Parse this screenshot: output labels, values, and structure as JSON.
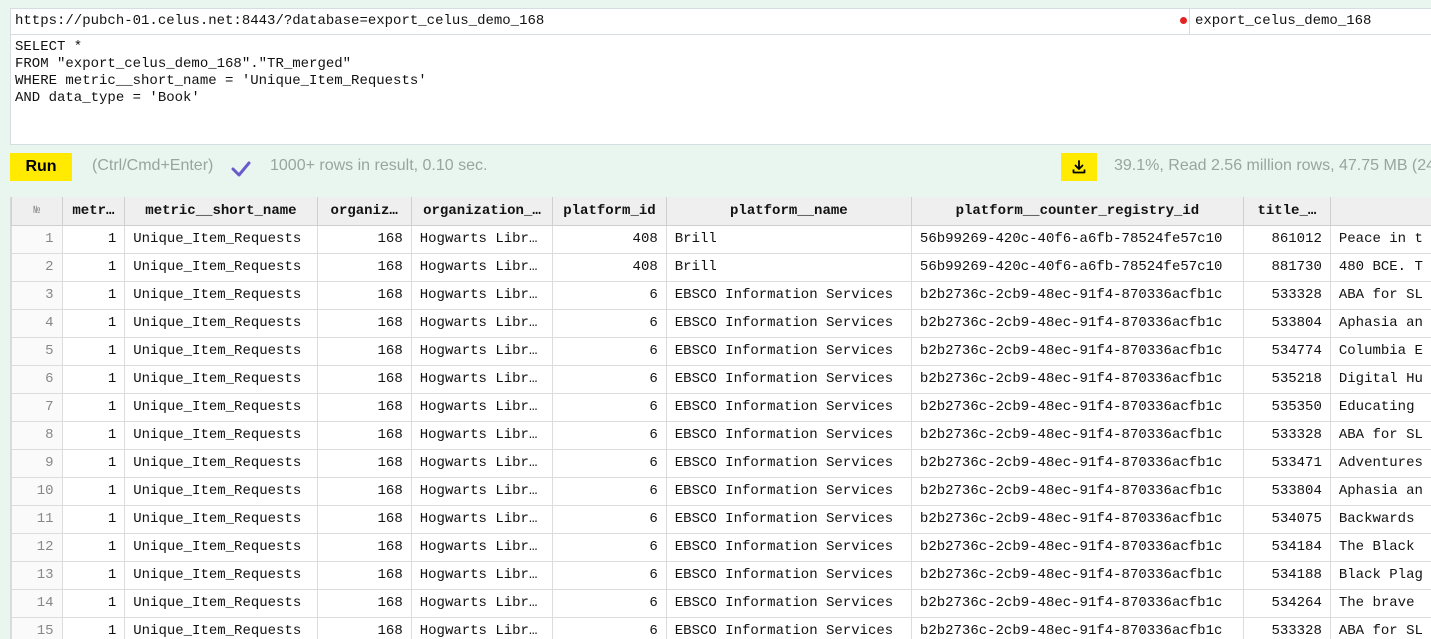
{
  "url": "https://pubch-01.celus.net:8443/?database=export_celus_demo_168",
  "database": "export_celus_demo_168",
  "query_lines": [
    "SELECT *",
    "FROM \"export_celus_demo_168\".\"TR_merged\"",
    "WHERE metric__short_name = 'Unique_Item_Requests'",
    "AND data_type = 'Book'"
  ],
  "toolbar": {
    "run_label": "Run",
    "shortcut": "(Ctrl/Cmd+Enter)",
    "result_info": "1000+ rows in result, 0.10 sec.",
    "progress": "39.1%, Read 2.56 million rows, 47.75 MB (24"
  },
  "icons": {
    "status": "status-dot-red",
    "check": "check-icon",
    "download": "download-icon"
  },
  "table": {
    "columns": [
      "№",
      "metr…",
      "metric__short_name",
      "organiz…",
      "organization_…",
      "platform_id",
      "platform__name",
      "platform__counter_registry_id",
      "title_…",
      ""
    ],
    "rows": [
      [
        "1",
        "1",
        "Unique_Item_Requests",
        "168",
        "Hogwarts Libr…",
        "408",
        "Brill",
        "56b99269-420c-40f6-a6fb-78524fe57c10",
        "861012",
        "Peace in t"
      ],
      [
        "2",
        "1",
        "Unique_Item_Requests",
        "168",
        "Hogwarts Libr…",
        "408",
        "Brill",
        "56b99269-420c-40f6-a6fb-78524fe57c10",
        "881730",
        "480 BCE. T"
      ],
      [
        "3",
        "1",
        "Unique_Item_Requests",
        "168",
        "Hogwarts Libr…",
        "6",
        "EBSCO Information Services",
        "b2b2736c-2cb9-48ec-91f4-870336acfb1c",
        "533328",
        "ABA for SL"
      ],
      [
        "4",
        "1",
        "Unique_Item_Requests",
        "168",
        "Hogwarts Libr…",
        "6",
        "EBSCO Information Services",
        "b2b2736c-2cb9-48ec-91f4-870336acfb1c",
        "533804",
        "Aphasia an"
      ],
      [
        "5",
        "1",
        "Unique_Item_Requests",
        "168",
        "Hogwarts Libr…",
        "6",
        "EBSCO Information Services",
        "b2b2736c-2cb9-48ec-91f4-870336acfb1c",
        "534774",
        "Columbia E"
      ],
      [
        "6",
        "1",
        "Unique_Item_Requests",
        "168",
        "Hogwarts Libr…",
        "6",
        "EBSCO Information Services",
        "b2b2736c-2cb9-48ec-91f4-870336acfb1c",
        "535218",
        "Digital Hu"
      ],
      [
        "7",
        "1",
        "Unique_Item_Requests",
        "168",
        "Hogwarts Libr…",
        "6",
        "EBSCO Information Services",
        "b2b2736c-2cb9-48ec-91f4-870336acfb1c",
        "535350",
        "Educating"
      ],
      [
        "8",
        "1",
        "Unique_Item_Requests",
        "168",
        "Hogwarts Libr…",
        "6",
        "EBSCO Information Services",
        "b2b2736c-2cb9-48ec-91f4-870336acfb1c",
        "533328",
        "ABA for SL"
      ],
      [
        "9",
        "1",
        "Unique_Item_Requests",
        "168",
        "Hogwarts Libr…",
        "6",
        "EBSCO Information Services",
        "b2b2736c-2cb9-48ec-91f4-870336acfb1c",
        "533471",
        "Adventures"
      ],
      [
        "10",
        "1",
        "Unique_Item_Requests",
        "168",
        "Hogwarts Libr…",
        "6",
        "EBSCO Information Services",
        "b2b2736c-2cb9-48ec-91f4-870336acfb1c",
        "533804",
        "Aphasia an"
      ],
      [
        "11",
        "1",
        "Unique_Item_Requests",
        "168",
        "Hogwarts Libr…",
        "6",
        "EBSCO Information Services",
        "b2b2736c-2cb9-48ec-91f4-870336acfb1c",
        "534075",
        "Backwards"
      ],
      [
        "12",
        "1",
        "Unique_Item_Requests",
        "168",
        "Hogwarts Libr…",
        "6",
        "EBSCO Information Services",
        "b2b2736c-2cb9-48ec-91f4-870336acfb1c",
        "534184",
        "The Black"
      ],
      [
        "13",
        "1",
        "Unique_Item_Requests",
        "168",
        "Hogwarts Libr…",
        "6",
        "EBSCO Information Services",
        "b2b2736c-2cb9-48ec-91f4-870336acfb1c",
        "534188",
        "Black Plag"
      ],
      [
        "14",
        "1",
        "Unique_Item_Requests",
        "168",
        "Hogwarts Libr…",
        "6",
        "EBSCO Information Services",
        "b2b2736c-2cb9-48ec-91f4-870336acfb1c",
        "534264",
        "The brave"
      ],
      [
        "15",
        "1",
        "Unique_Item_Requests",
        "168",
        "Hogwarts Libr…",
        "6",
        "EBSCO Information Services",
        "b2b2736c-2cb9-48ec-91f4-870336acfb1c",
        "533328",
        "ABA for SL"
      ]
    ]
  }
}
